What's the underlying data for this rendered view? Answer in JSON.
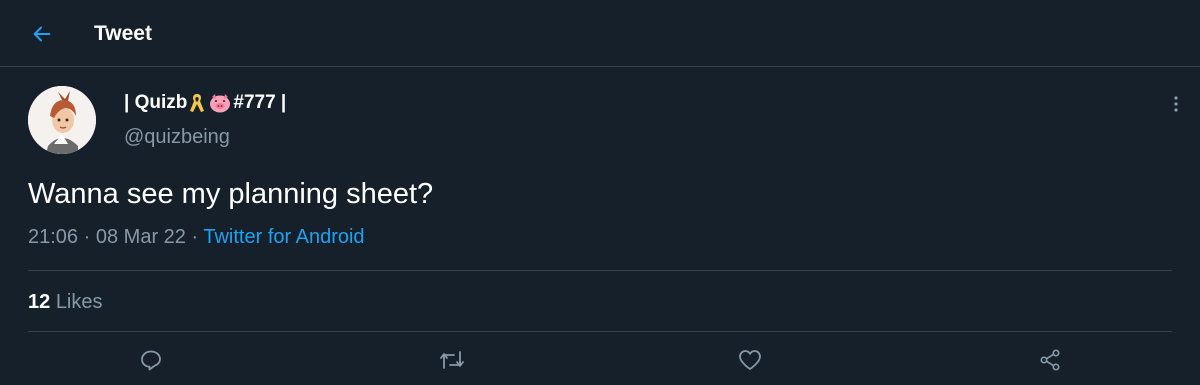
{
  "header": {
    "title": "Tweet",
    "back_icon": "arrow-left-icon",
    "accent": "#1da1f2"
  },
  "author": {
    "name_prefix": "| Quizb ",
    "name_suffix": "#777 |",
    "name_emojis": [
      "yellow-ribbon",
      "pig-face"
    ],
    "handle": "@quizbeing"
  },
  "tweet": {
    "text": "Wanna see my planning sheet?",
    "time": "21:06",
    "separator": "·",
    "date": "08 Mar 22",
    "source": "Twitter for Android"
  },
  "stats": {
    "likes_count": "12",
    "likes_label": "Likes"
  },
  "actions": [
    "reply-icon",
    "retweet-icon",
    "like-icon",
    "share-icon"
  ],
  "colors": {
    "background": "#15202b",
    "border": "#38444d",
    "secondary_text": "#8899a6",
    "link": "#1da1f2"
  }
}
